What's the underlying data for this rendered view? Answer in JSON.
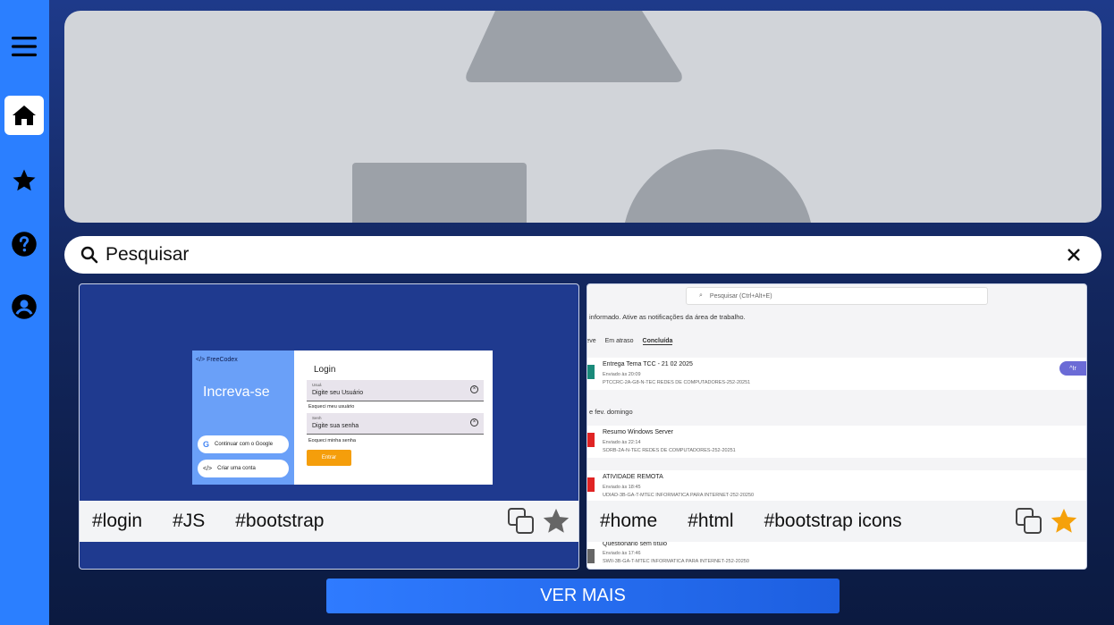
{
  "sidebar": {
    "items": [
      {
        "name": "menu",
        "icon": "hamburger-menu-icon"
      },
      {
        "name": "home",
        "icon": "home-icon",
        "active": true
      },
      {
        "name": "favorites",
        "icon": "star-icon"
      },
      {
        "name": "help",
        "icon": "help-icon"
      },
      {
        "name": "account",
        "icon": "user-icon"
      }
    ],
    "color": "#2b7fff"
  },
  "search": {
    "placeholder": "Pesquisar"
  },
  "cards": [
    {
      "tags": [
        "#login",
        "#JS",
        "#bootstrap"
      ],
      "favorited": false,
      "preview": {
        "brand": "</> FreeCodex",
        "side_title": "Increva-se",
        "google_btn": "Continuar com o Google",
        "create_btn": "Criar uma conta",
        "login_title": "Login",
        "user_label": "Usuá",
        "user_value": "Digite seu Usuário",
        "forgot_user": "Esqueci meu usuário",
        "pass_label": "Senh",
        "pass_value": "Digite sua senha",
        "forgot_pass": "Eoqueci minha senha",
        "enter_btn": "Entrar"
      }
    },
    {
      "tags": [
        "#home",
        "#html",
        "#bootstrap icons"
      ],
      "favorited": true,
      "preview": {
        "search": "Pesquisar (Ctrl+Alt+E)",
        "notice": "informado. Ative as notificações da área de trabalho.",
        "tabs": [
          "reve",
          "Em atraso",
          "Concluída"
        ],
        "day": "e fev. domingo",
        "ir": "Ir",
        "items": [
          {
            "title": "Entrega Tema TCC - 21 02 2025",
            "sent": "Enviado às 20:09",
            "class": "PTCCRC-2A-G8-N-TEC REDES DE COMPUTADORES-252-20251",
            "color": "#1a8a7a"
          },
          {
            "title": "Resumo Windows Server",
            "sent": "Enviado às 22:14",
            "class": "SORB-2A-N-TEC REDES DE COMPUTADORES-252-20251",
            "color": "#e02424"
          },
          {
            "title": "ATIVIDADE REMOTA",
            "sent": "Enviado às 18:45",
            "class": "UDIAD-3B-GA-T-MTEC INFORMATICA PARA INTERNET-252-20250",
            "color": "#e02424"
          },
          {
            "title": "Questionário sem título",
            "sent": "Enviado às 17:46",
            "class": "SWII-3B-GA-T-MTEC INFORMATICA PARA INTERNET-252-20250",
            "color": "#666666"
          }
        ]
      }
    }
  ],
  "ver_mais": "VER MAIS",
  "colors": {
    "star_active": "#f5a10b",
    "star_inactive": "#666666"
  }
}
